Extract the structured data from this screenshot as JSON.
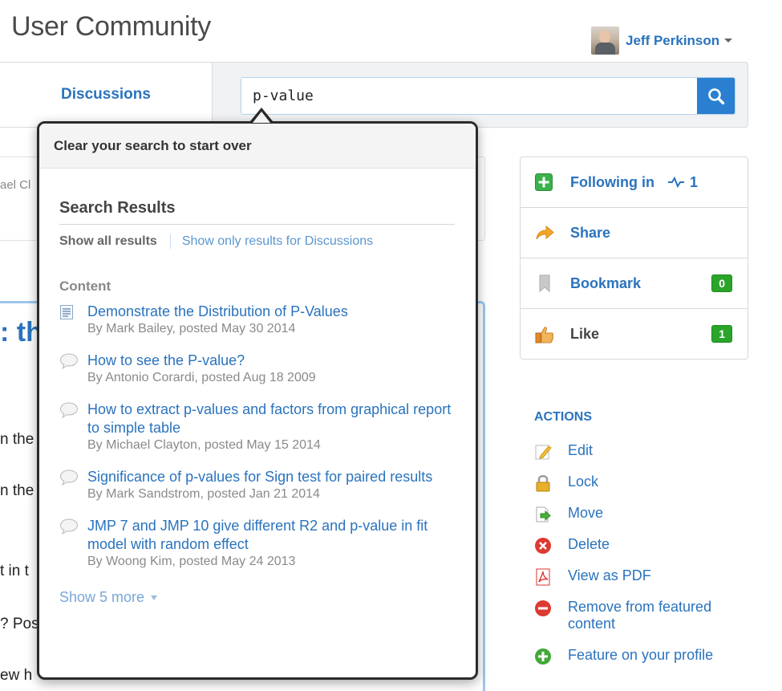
{
  "site": {
    "title": "User Community"
  },
  "user": {
    "name": "Jeff Perkinson"
  },
  "nav": {
    "active_tab": "Discussions",
    "search_value": "p-value"
  },
  "background": {
    "card_text": "ael Cl",
    "heading_fragment": ": th",
    "text_fragments": [
      "n the",
      "n the",
      "t in t",
      "? Pos",
      "ew h"
    ]
  },
  "search_dropdown": {
    "clear_label": "Clear your search to start over",
    "title": "Search Results",
    "filter_all": "Show all results",
    "filter_discussions": "Show only results for Discussions",
    "section_label": "Content",
    "results": [
      {
        "icon": "document-icon",
        "title": "Demonstrate the Distribution of P-Values",
        "meta": "By Mark Bailey, posted May 30 2014"
      },
      {
        "icon": "speech-bubble-icon",
        "title": "How to see the P-value?",
        "meta": "By Antonio Corardi, posted Aug 18 2009"
      },
      {
        "icon": "speech-bubble-icon",
        "title": "How to extract p-values and factors from graphical report to simple table",
        "meta": "By Michael Clayton, posted May 15 2014"
      },
      {
        "icon": "speech-bubble-icon",
        "title": "Significance of p-values for Sign test for paired results",
        "meta": "By Mark Sandstrom, posted Jan 21 2014"
      },
      {
        "icon": "speech-bubble-icon",
        "title": "JMP 7 and JMP 10 give different R2 and p-value in fit model with random effect",
        "meta": "By Woong Kim, posted May 24 2013"
      }
    ],
    "show_more": "Show 5 more"
  },
  "sidebar": {
    "following_label": "Following in",
    "following_count": "1",
    "share_label": "Share",
    "bookmark_label": "Bookmark",
    "bookmark_count": "0",
    "like_label": "Like",
    "like_count": "1"
  },
  "actions": {
    "heading": "ACTIONS",
    "items": [
      {
        "label": "Edit",
        "icon": "pencil-icon"
      },
      {
        "label": "Lock",
        "icon": "lock-icon"
      },
      {
        "label": "Move",
        "icon": "move-icon"
      },
      {
        "label": "Delete",
        "icon": "delete-icon"
      },
      {
        "label": "View as PDF",
        "icon": "pdf-icon"
      },
      {
        "label": "Remove from featured content",
        "icon": "remove-icon"
      },
      {
        "label": "Feature on your profile",
        "icon": "add-icon"
      }
    ]
  },
  "colors": {
    "link": "#2a73be",
    "search_button": "#2a7fd0",
    "badge_green": "#2aa52a"
  }
}
